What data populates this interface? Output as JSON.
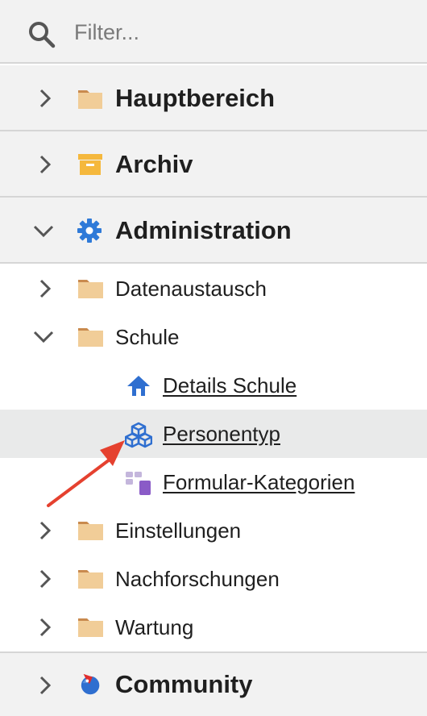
{
  "filter": {
    "placeholder": "Filter..."
  },
  "sections": {
    "hauptbereich": {
      "label": "Hauptbereich",
      "icon": "folder-icon",
      "expanded": false
    },
    "archiv": {
      "label": "Archiv",
      "icon": "archive-box-icon",
      "expanded": false
    },
    "administration": {
      "label": "Administration",
      "icon": "gear-icon",
      "expanded": true
    },
    "community": {
      "label": "Community",
      "icon": "community-globe-icon",
      "expanded": false
    }
  },
  "tree": {
    "datenaustausch": {
      "label": "Datenaustausch",
      "expanded": false
    },
    "schule": {
      "label": "Schule",
      "expanded": true
    },
    "details_schule": {
      "label": "Details Schule",
      "icon": "house-icon"
    },
    "personentyp": {
      "label": "Personentyp",
      "icon": "cubes-icon",
      "selected": true
    },
    "formular_kategorien": {
      "label": "Formular-Kategorien",
      "icon": "form-categories-icon"
    },
    "einstellungen": {
      "label": "Einstellungen",
      "expanded": false
    },
    "nachforschungen": {
      "label": "Nachforschungen",
      "expanded": false
    },
    "wartung": {
      "label": "Wartung",
      "expanded": false
    }
  },
  "colors": {
    "folder": "#f1cd98",
    "folder_tab": "#c98a4e",
    "archive": "#f5b83d",
    "gear": "#2f7ad8",
    "link_icon_blue": "#2f6fd0",
    "annotation_arrow": "#e5412f",
    "row_selected": "#e9eaea",
    "panel": "#f2f2f2"
  }
}
